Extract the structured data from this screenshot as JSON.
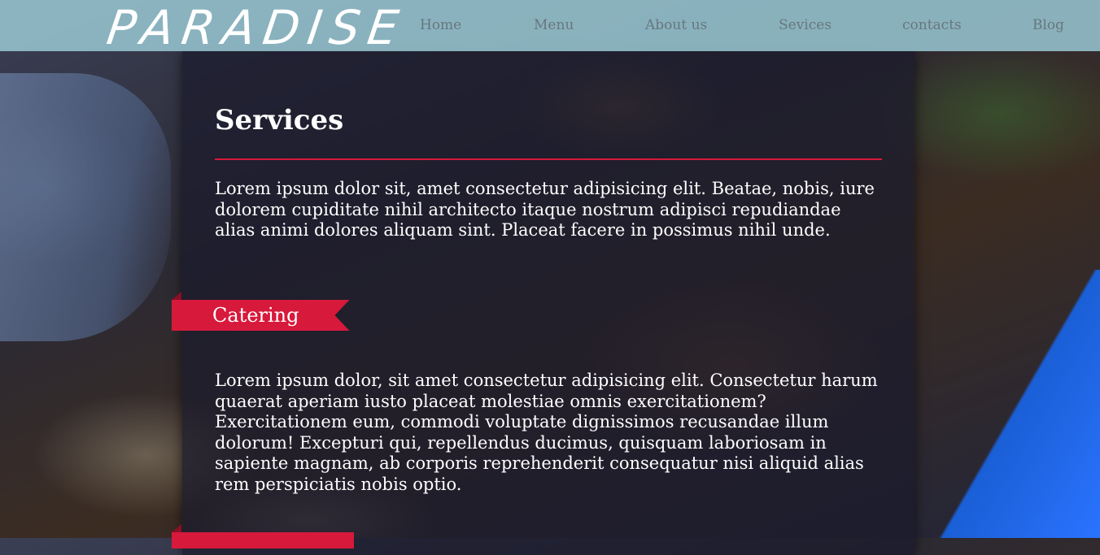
{
  "header": {
    "logo": "PARADISE",
    "nav": [
      "Home",
      "Menu",
      "About us",
      "Sevices",
      "contacts",
      "Blog"
    ]
  },
  "main": {
    "title": "Services",
    "intro": "Lorem ipsum dolor sit, amet consectetur adipisicing elit. Beatae, nobis, iure dolorem cupiditate nihil architecto itaque nostrum adipisci repudiandae alias animi dolores aliquam sint. Placeat facere in possimus nihil unde.",
    "sections": [
      {
        "ribbon": "Catering",
        "text": "Lorem ipsum dolor, sit amet consectetur adipisicing elit. Consectetur harum quaerat aperiam iusto placeat molestiae omnis exercitationem? Exercitationem eum, commodi voluptate dignissimos recusandae illum dolorum! Excepturi qui, repellendus ducimus, quisquam laboriosam in sapiente magnam, ab corporis reprehenderit consequatur nisi aliquid alias rem perspiciatis nobis optio."
      }
    ]
  },
  "colors": {
    "header_bg": "#96c4cf",
    "accent": "#d7193b",
    "nav_text": "#66777e",
    "panel": "#1a1a2c"
  }
}
